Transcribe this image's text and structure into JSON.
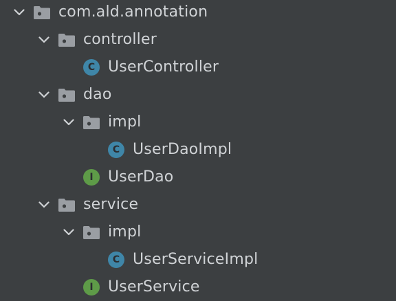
{
  "colors": {
    "background": "#3c3f41",
    "text": "#d0d3d6",
    "folder": "#9a9ea3",
    "class_badge": "#3f86a8",
    "interface_badge": "#5e9b48"
  },
  "tree": [
    {
      "depth": 0,
      "label": "com.ald.annotation",
      "kind": "package",
      "expanded": true,
      "icon": "package-folder-icon"
    },
    {
      "depth": 1,
      "label": "controller",
      "kind": "package",
      "expanded": true,
      "icon": "package-folder-icon"
    },
    {
      "depth": 2,
      "label": "UserController",
      "kind": "class",
      "badge": "C",
      "icon": "class-icon"
    },
    {
      "depth": 1,
      "label": "dao",
      "kind": "package",
      "expanded": true,
      "icon": "package-folder-icon"
    },
    {
      "depth": 2,
      "label": "impl",
      "kind": "package",
      "expanded": true,
      "icon": "package-folder-icon"
    },
    {
      "depth": 3,
      "label": "UserDaoImpl",
      "kind": "class",
      "badge": "C",
      "icon": "class-icon"
    },
    {
      "depth": 2,
      "label": "UserDao",
      "kind": "interface",
      "badge": "I",
      "icon": "interface-icon"
    },
    {
      "depth": 1,
      "label": "service",
      "kind": "package",
      "expanded": true,
      "icon": "package-folder-icon"
    },
    {
      "depth": 2,
      "label": "impl",
      "kind": "package",
      "expanded": true,
      "icon": "package-folder-icon"
    },
    {
      "depth": 3,
      "label": "UserServiceImpl",
      "kind": "class",
      "badge": "C",
      "icon": "class-icon"
    },
    {
      "depth": 2,
      "label": "UserService",
      "kind": "interface",
      "badge": "I",
      "icon": "interface-icon"
    }
  ]
}
